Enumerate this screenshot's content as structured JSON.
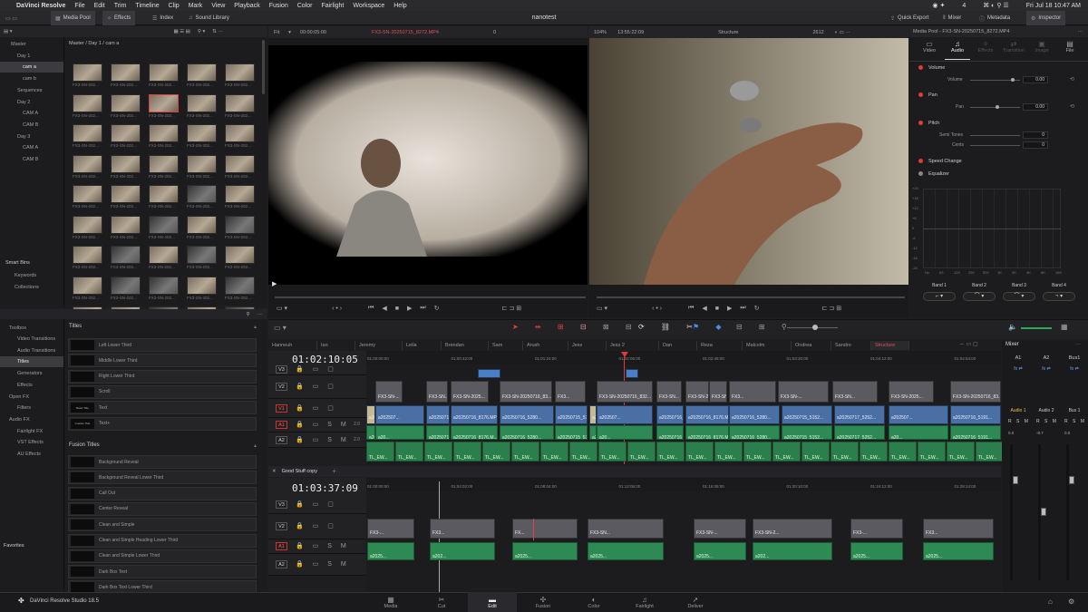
{
  "menubar": {
    "app": "DaVinci Resolve",
    "items": [
      "File",
      "Edit",
      "Trim",
      "Timeline",
      "Clip",
      "Mark",
      "View",
      "Playback",
      "Fusion",
      "Color",
      "Fairlight",
      "Workspace",
      "Help"
    ],
    "battery": "4",
    "datetime": "Fri Jul 18  10:47 AM"
  },
  "toolbar": {
    "media_pool": "Media Pool",
    "effects": "Effects",
    "index": "Index",
    "sound_library": "Sound Library",
    "project": "nanotest",
    "quick_export": "Quick Export",
    "mixer": "Mixer",
    "metadata": "Metadata",
    "inspector": "Inspector"
  },
  "viewers": {
    "fit": "Fit",
    "src_tc": "00:00:05:00",
    "src_clip": "FX3-SN-20250715_8272.MP4",
    "src_num": "0",
    "zoom": "104%",
    "rec_tc": "13:55:22:09",
    "timeline_name": "Structure",
    "frame": "2612"
  },
  "mediapool": {
    "breadcrumb": "Master / Day 1 / cam a",
    "bins": [
      "Master",
      "Day 1",
      "cam a",
      "cam b",
      "Sequences",
      "Day 2",
      "CAM A",
      "CAM B",
      "Day 3",
      "CAM A",
      "CAM B"
    ],
    "smart_bins": "Smart Bins",
    "smart_items": [
      "Keywords",
      "Collections"
    ],
    "thumb_label": "FX3-SN-202..."
  },
  "effects": {
    "categories": [
      "Toolbox",
      "Video Transitions",
      "Audio Transitions",
      "Titles",
      "Generators",
      "Effects",
      "Open FX",
      "Filters",
      "Audio FX",
      "Fairlight FX",
      "VST Effects",
      "AU Effects"
    ],
    "favorites": "Favorites",
    "titles_header": "Titles",
    "titles": [
      "Left Lower Third",
      "Middle Lower Third",
      "Right Lower Third",
      "Scroll",
      "Text",
      "Text+"
    ],
    "fusion_header": "Fusion Titles",
    "fusion_titles": [
      "Background Reveal",
      "Background Reveal Lower Third",
      "Call Out",
      "Center Reveal",
      "Clean and Simple",
      "Clean and Simple Heading Lower Third",
      "Clean and Simple Lower Third",
      "Dark Box Text",
      "Dark Box Text Lower Third"
    ],
    "thumb_basic": "Basic Title",
    "thumb_custom": "Custom Title"
  },
  "inspector": {
    "clip": "Media Pool - FX3-SN-20250715_8272.MP4",
    "tabs": [
      "Video",
      "Audio",
      "Effects",
      "Transition",
      "Image",
      "File"
    ],
    "volume": "Volume",
    "volume_lbl": "Volume",
    "volume_val": "0.00",
    "pan": "Pan",
    "pan_lbl": "Pan",
    "pan_val": "0.00",
    "pitch": "Pitch",
    "semitones": "Semi Tones",
    "semitones_val": "0",
    "cents": "Cents",
    "cents_val": "0",
    "speed": "Speed Change",
    "eq": "Equalizer",
    "eq_y": [
      "+24",
      "+18",
      "+12",
      "+6",
      "0",
      "-6",
      "-12",
      "-18",
      "-24"
    ],
    "eq_x": [
      "Hz",
      "63",
      "125",
      "250",
      "500",
      "1K",
      "2K",
      "4K",
      "8K",
      "16K"
    ],
    "bands": [
      "Band 1",
      "Band 2",
      "Band 3",
      "Band 4"
    ]
  },
  "timeline_tabs": [
    "Hanneuh",
    "Ian",
    "Jeremy",
    "Leila",
    "Brendan",
    "Sam",
    "Arush",
    "Jess",
    "Jess 2",
    "Dan",
    "Reza",
    "Malcolm",
    "Ondrea",
    "Sandro",
    "Structure"
  ],
  "timeline1": {
    "tc": "01:02:10:05",
    "ruler": [
      "01:00:00:00",
      "01:00:42:00",
      "01:01:24:00",
      "01:02:06:00",
      "01:02:48:00",
      "01:03:30:00",
      "01:04:12:00",
      "01:04:54:00"
    ],
    "tracks": [
      "V3",
      "V2",
      "V1",
      "A1",
      "A2"
    ],
    "a_level": "2.0",
    "v2clips": [
      "FX3-SN-...",
      "FX3-SN...",
      "FX3-SN-2025...",
      "FX3-SN-20250716_83...",
      "FX3...",
      "FX3-SN-20250716_832...",
      "FX3-SN...",
      "FX3-SN-20250714_8414...",
      "FX3-SN-20250715_8291...",
      "FX3..."
    ],
    "v1clips": [
      "a20250717_5252...",
      "a202507...",
      "a20250716_5191...",
      "a20250716_8176.MP4",
      "a20250716_5280...",
      "a20250715_5152..."
    ],
    "a1clips": [
      "a20250717_5252...",
      "a20...",
      "a20250716_5191...",
      "a20250716_8176.M...",
      "a20250716_5280...",
      "a20250715_5152..."
    ],
    "a2clip": "TL_EW..."
  },
  "timeline2": {
    "name": "Good Stuff copy",
    "tc": "01:03:37:09",
    "ruler": [
      "01:00:00:00",
      "01:04:02:00",
      "01:08:04:00",
      "01:12:06:00",
      "01:16:08:00",
      "01:20:10:00",
      "01:24:12:00",
      "01:28:14:00"
    ],
    "tracks": [
      "V3",
      "V2",
      "A1",
      "A2"
    ],
    "v2clips": [
      "FX3-...",
      "FX3...",
      "FX...",
      "FX3-SN...",
      "FX3-SN-...",
      "FX3-SN-2..."
    ],
    "a1clips": [
      "a2025...",
      "a202...",
      "a2025...",
      "a2025..."
    ]
  },
  "mixer": {
    "title": "Mixer",
    "channels": [
      "A1",
      "A2",
      "Bus1"
    ],
    "audio_labels": [
      "Audio 1",
      "Audio 2",
      "Bus 1"
    ],
    "vals": [
      "0.0",
      "-8.7",
      "0.0"
    ]
  },
  "pages": [
    "Media",
    "Cut",
    "Edit",
    "Fusion",
    "Color",
    "Fairlight",
    "Deliver"
  ],
  "product": "DaVinci Resolve Studio 18.5"
}
